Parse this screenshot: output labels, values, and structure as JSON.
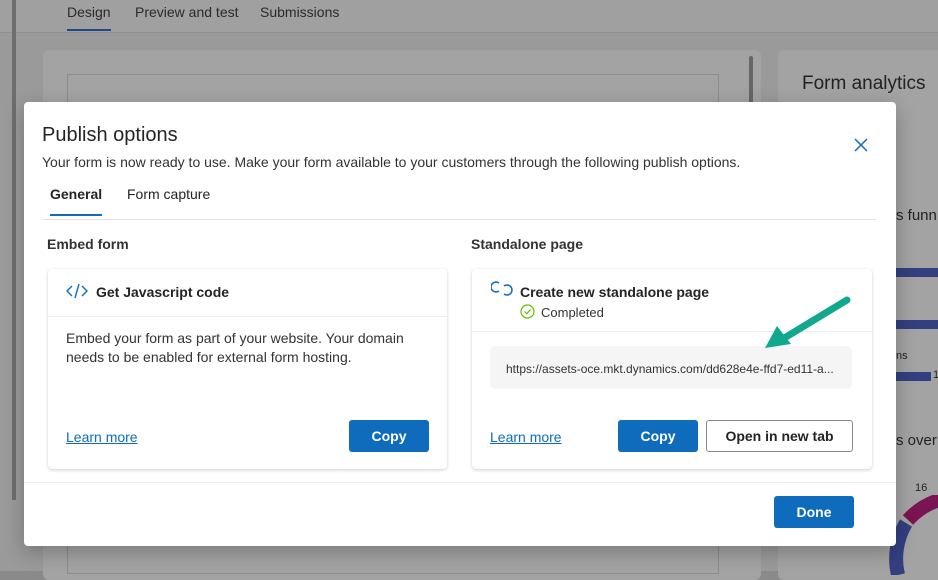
{
  "background": {
    "tabs": [
      "Design",
      "Preview and test",
      "Submissions"
    ],
    "analytics_title": "Form analytics",
    "fragments": [
      "s funn",
      "ns",
      "1",
      "s over",
      "16"
    ]
  },
  "modal": {
    "title": "Publish options",
    "subtitle": "Your form is now ready to use. Make your form available to your customers through the following publish options.",
    "tabs": [
      "General",
      "Form capture"
    ],
    "embed": {
      "section": "Embed form",
      "card_title": "Get Javascript code",
      "body": "Embed your form as part of your website. Your domain needs to be enabled for external form hosting.",
      "learn_more": "Learn more",
      "copy": "Copy"
    },
    "standalone": {
      "section": "Standalone page",
      "card_title": "Create new standalone page",
      "status": "Completed",
      "url": "https://assets-oce.mkt.dynamics.com/dd628e4e-ffd7-ed11-a...",
      "learn_more": "Learn more",
      "copy": "Copy",
      "open": "Open in new tab"
    },
    "done": "Done"
  },
  "colors": {
    "accent": "#0f6cbd",
    "success": "#6bb700",
    "arrow": "#12a88e"
  }
}
